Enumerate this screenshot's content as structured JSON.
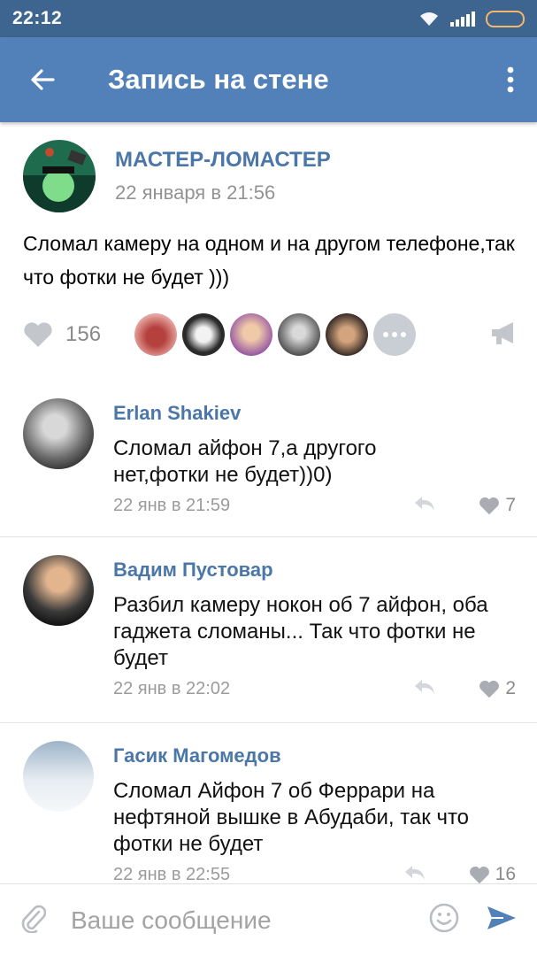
{
  "status_bar": {
    "time": "22:12"
  },
  "app_bar": {
    "title": "Запись на стене"
  },
  "post": {
    "author": "МАСТЕР-ЛОМАСТЕР",
    "date": "22 января в 21:56",
    "text": "Сломал камеру на одном и на другом телефоне,так что фотки не будет )))",
    "like_count": "156"
  },
  "comments": [
    {
      "author": "Erlan Shakiev",
      "text": "Сломал айфон 7,а другого нет,фотки не будет))0)",
      "date": "22 янв в 21:59",
      "likes": "7"
    },
    {
      "author": "Вадим Пустовар",
      "text": "Разбил камеру нокон об 7 айфон, оба гаджета сломаны... Так что фотки не будет",
      "date": "22 янв в 22:02",
      "likes": "2"
    },
    {
      "author": "Гасик Магомедов",
      "text": "Сломал Айфон 7 об  Феррари на нефтяной вышке в Абудаби, так что фотки не будет",
      "date": "22 янв в 22:55",
      "likes": "16"
    }
  ],
  "composer": {
    "placeholder": "Ваше сообщение"
  },
  "colors": {
    "header": "#5181b8",
    "status_bar": "#3e6490",
    "link": "#4a76a8",
    "meta": "#939393"
  }
}
